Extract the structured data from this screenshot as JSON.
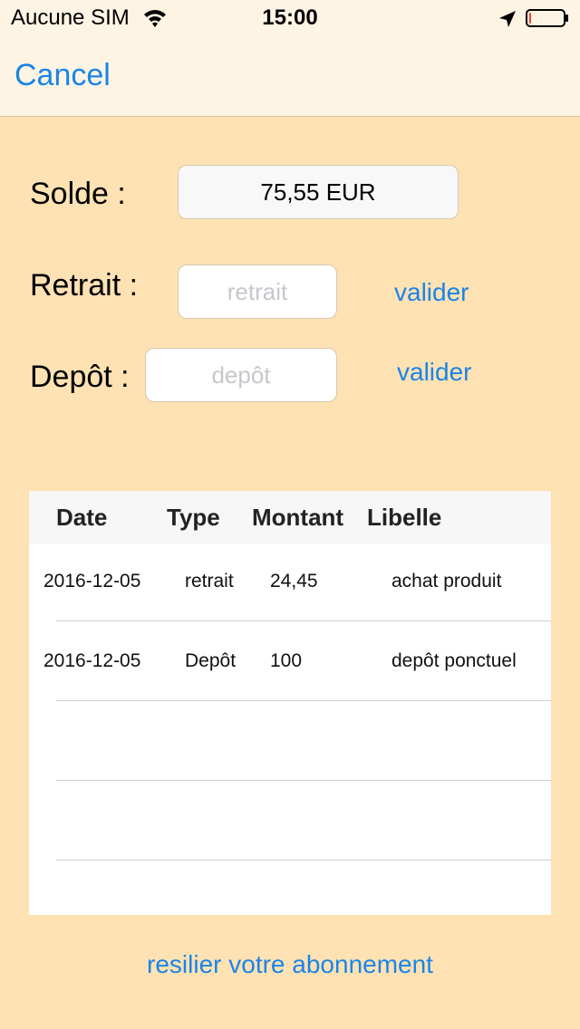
{
  "status_bar": {
    "carrier": "Aucune SIM",
    "time": "15:00",
    "battery_level": 0.05
  },
  "nav": {
    "cancel_label": "Cancel"
  },
  "form": {
    "solde_label": "Solde :",
    "solde_value": "75,55 EUR",
    "retrait_label": "Retrait :",
    "retrait_placeholder": "retrait",
    "retrait_valider": "valider",
    "depot_label": "Depôt :",
    "depot_placeholder": "depôt",
    "depot_valider": "valider"
  },
  "table": {
    "headers": [
      "Date",
      "Type",
      "Montant",
      "Libelle"
    ],
    "rows": [
      [
        "2016-12-05",
        "retrait",
        "24,45",
        "achat produit"
      ],
      [
        "2016-12-05",
        "Depôt",
        "100",
        "depôt ponctuel"
      ]
    ]
  },
  "footer": {
    "resilier_label": "resilier votre abonnement"
  },
  "colors": {
    "background": "#FFE2B3",
    "accent": "#1A84E8",
    "bar": "#FEF4E4"
  }
}
